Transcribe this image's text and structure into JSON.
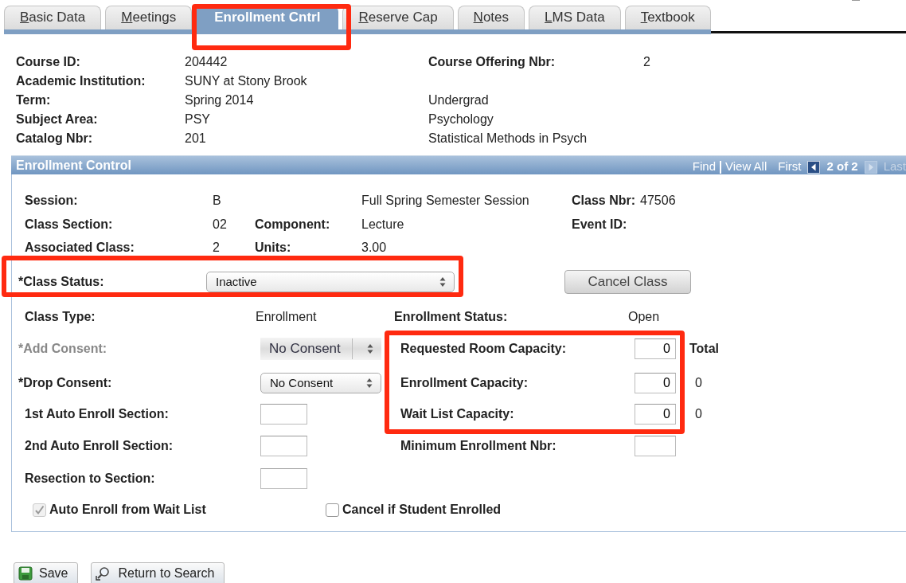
{
  "tabs": [
    {
      "label": "Basic Data",
      "selected": false
    },
    {
      "label": "Meetings",
      "selected": false
    },
    {
      "label": "Enrollment Cntrl",
      "selected": true
    },
    {
      "label": "Reserve Cap",
      "selected": false
    },
    {
      "label": "Notes",
      "selected": false
    },
    {
      "label": "LMS Data",
      "selected": false
    },
    {
      "label": "Textbook",
      "selected": false
    }
  ],
  "course": [
    {
      "label": "Course ID:",
      "value": "204442",
      "side": {
        "kind": "field",
        "label": "Course Offering Nbr:",
        "value": "2"
      }
    },
    {
      "label": "Academic Institution:",
      "value": "SUNY at Stony Brook"
    },
    {
      "label": "Term:",
      "value": "Spring 2014",
      "side": {
        "kind": "text",
        "text": "Undergrad"
      }
    },
    {
      "label": "Subject Area:",
      "value": "PSY",
      "side": {
        "kind": "text",
        "text": "Psychology"
      }
    },
    {
      "label": "Catalog Nbr:",
      "value": "201",
      "side": {
        "kind": "text",
        "text": "Statistical Methods in Psych"
      }
    }
  ],
  "enrollment_control": {
    "title": "Enrollment Control",
    "nav": {
      "find": "Find",
      "view_all": "View All",
      "first": "First",
      "counter": "2 of 2",
      "last": "Last",
      "prev_disabled": false,
      "next_disabled": true
    },
    "session": {
      "label": "Session:",
      "value": "B",
      "description": "Full Spring Semester Session"
    },
    "class_nbr": {
      "label": "Class Nbr:",
      "value": "47506"
    },
    "class_section": {
      "label": "Class Section:",
      "value": "02"
    },
    "component": {
      "label": "Component:",
      "value": "Lecture"
    },
    "event_id": {
      "label": "Event ID:"
    },
    "associated_class": {
      "label": "Associated Class:",
      "value": "2"
    },
    "units": {
      "label": "Units:",
      "value": "3.00"
    },
    "class_status": {
      "label": "*Class Status:",
      "value": "Inactive"
    },
    "cancel_button": "Cancel Class",
    "class_type": {
      "label": "Class Type:",
      "value": "Enrollment"
    },
    "enrollment_status": {
      "label": "Enrollment Status:",
      "value": "Open"
    },
    "consents": [
      {
        "label": "*Add Consent:",
        "value": "No Consent",
        "disabled": true
      },
      {
        "label": "*Drop Consent:",
        "value": "No Consent",
        "disabled": false
      }
    ],
    "sections": [
      {
        "label": "1st Auto Enroll Section:"
      },
      {
        "label": "2nd Auto Enroll Section:"
      },
      {
        "label": "Resection to Section:"
      }
    ],
    "capacities": [
      {
        "label": "Requested Room Capacity:",
        "value": "0",
        "total": "Total"
      },
      {
        "label": "Enrollment Capacity:",
        "value": "0",
        "total": "0"
      },
      {
        "label": "Wait List Capacity:",
        "value": "0",
        "total": "0"
      },
      {
        "label": "Minimum Enrollment Nbr:"
      }
    ],
    "checkboxes": [
      {
        "label": "Auto Enroll from Wait List",
        "checked": true,
        "disabled": true
      },
      {
        "label": "Cancel if Student Enrolled",
        "checked": false,
        "disabled": false
      }
    ]
  },
  "buttons": [
    {
      "kind": "save",
      "label": "Save"
    },
    {
      "kind": "search",
      "label": "Return to Search"
    }
  ],
  "highlights": [
    {
      "kind": "tab"
    },
    {
      "kind": "status"
    },
    {
      "kind": "capacity"
    }
  ]
}
